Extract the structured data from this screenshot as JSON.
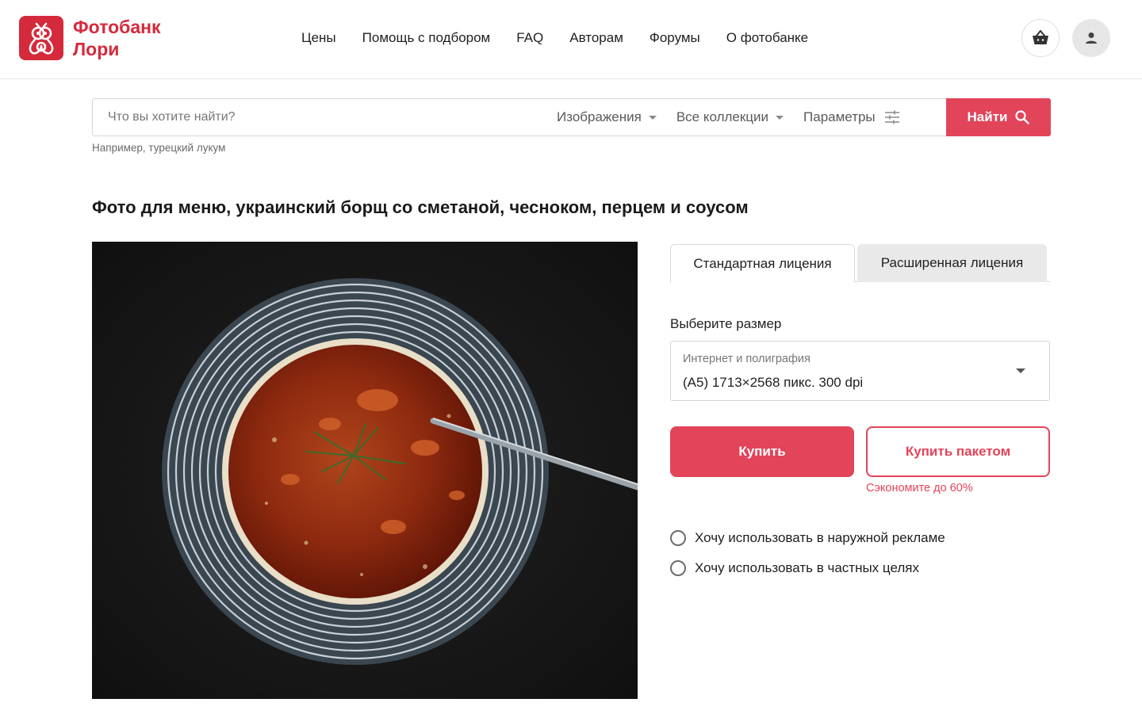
{
  "header": {
    "logo_text_line1": "Фотобанк",
    "logo_text_line2": "Лори",
    "nav": [
      "Цены",
      "Помощь с подбором",
      "FAQ",
      "Авторам",
      "Форумы",
      "О фотобанке"
    ]
  },
  "search": {
    "placeholder": "Что вы хотите найти?",
    "type_dropdown": "Изображения",
    "collection_dropdown": "Все коллекции",
    "params_label": "Параметры",
    "submit_label": "Найти",
    "hint": "Например, турецкий лукум"
  },
  "page": {
    "title": "Фото для меню, украинский борщ со сметаной, чесноком, перцем и соусом"
  },
  "license": {
    "tabs": [
      {
        "label": "Стандартная лицения",
        "active": true
      },
      {
        "label": "Расширенная лицения",
        "active": false
      }
    ],
    "size_label": "Выберите размер",
    "size_category": "Интернет и полиграфия",
    "size_value": "(А5) 1713×2568 пикс. 300 dpi",
    "buy_label": "Купить",
    "buy_pack_label": "Купить пакетом",
    "save_note": "Сэкономите до 60%",
    "options": [
      "Хочу использовать в наружной рекламе",
      "Хочу использовать в частных целях"
    ]
  },
  "colors": {
    "brand": "#d42a3c",
    "accent": "#e2445a"
  },
  "icons": [
    "cart-icon",
    "user-icon",
    "sliders-icon",
    "search-icon",
    "chevron-down-icon"
  ]
}
